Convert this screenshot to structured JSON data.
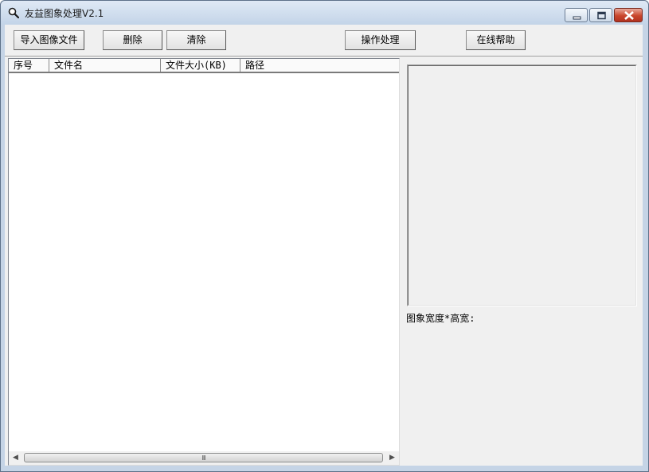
{
  "window": {
    "title": "友益图象处理V2.1"
  },
  "toolbar": {
    "import_label": "导入图像文件",
    "delete_label": "删除",
    "clear_label": "清除",
    "process_label": "操作处理",
    "help_label": "在线帮助"
  },
  "list": {
    "columns": [
      "序号",
      "文件名",
      "文件大小(KB)",
      "路径"
    ],
    "scroll_grip": "III"
  },
  "preview": {
    "size_label": "图象宽度*高宽:"
  },
  "colors": {
    "titlebar": "#c3d4e8",
    "close_button": "#c9462c",
    "client_bg": "#f0f0f0"
  }
}
